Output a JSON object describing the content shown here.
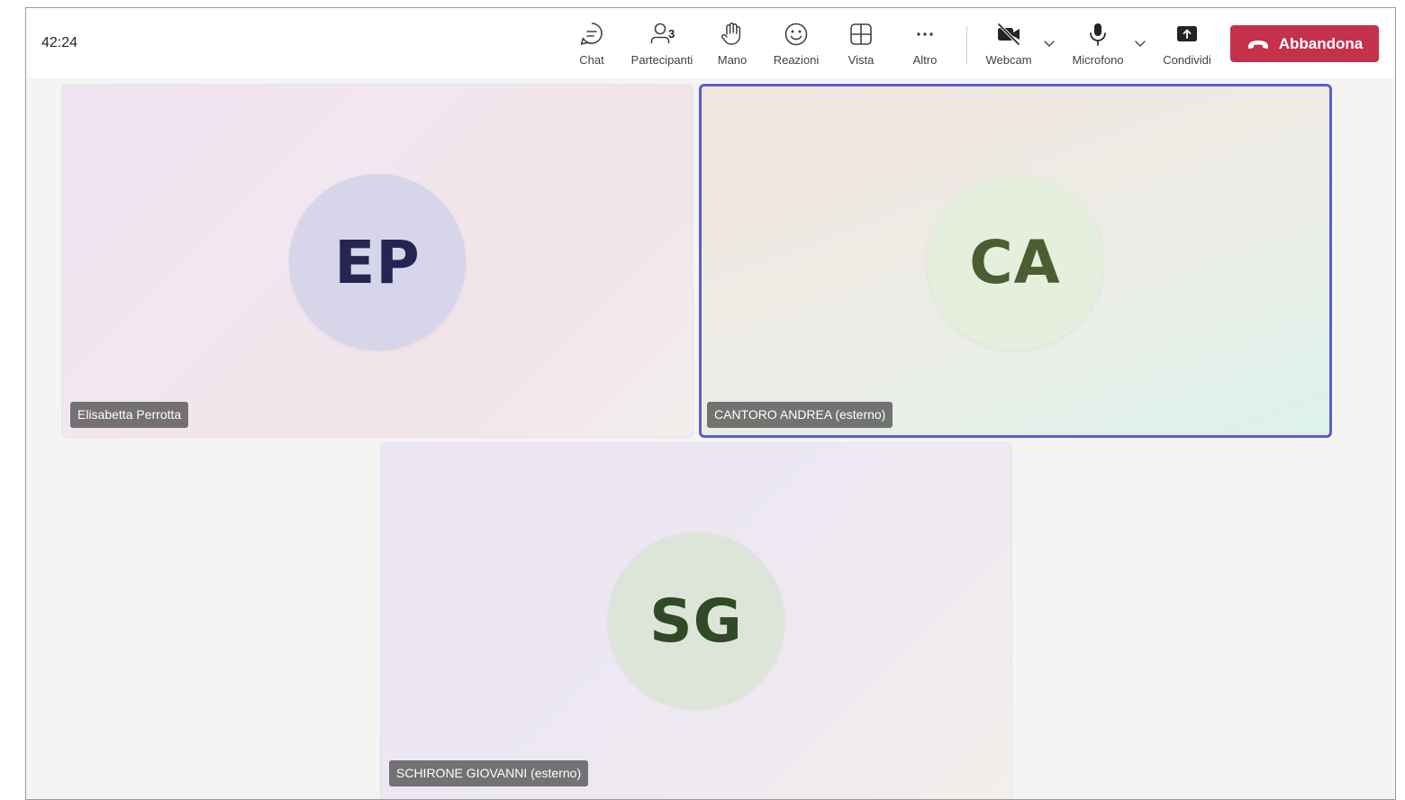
{
  "meeting": {
    "timer": "42:24"
  },
  "toolbar": {
    "chat": {
      "label": "Chat",
      "icon": "chat-icon"
    },
    "participants": {
      "label": "Partecipanti",
      "icon": "people-icon",
      "count": "3"
    },
    "hand": {
      "label": "Mano",
      "icon": "raise-hand-icon"
    },
    "reactions": {
      "label": "Reazioni",
      "icon": "smiley-icon"
    },
    "view": {
      "label": "Vista",
      "icon": "grid-view-icon"
    },
    "more": {
      "label": "Altro",
      "icon": "more-icon"
    },
    "webcam": {
      "label": "Webcam",
      "icon": "camera-off-icon"
    },
    "microphone": {
      "label": "Microfono",
      "icon": "microphone-icon"
    },
    "share": {
      "label": "Condividi",
      "icon": "share-screen-icon"
    },
    "leave": {
      "label": "Abbandona",
      "icon": "hang-up-icon",
      "color": "#c4314b"
    }
  },
  "participants": [
    {
      "initials": "EP",
      "name": "Elisabetta Perrotta",
      "avatar_color": "#d6d5ea",
      "initials_color": "#252452",
      "active_speaker": false
    },
    {
      "initials": "CA",
      "name": "CANTORO ANDREA (esterno)",
      "avatar_color": "#e6eedd",
      "initials_color": "#4a5e32",
      "active_speaker": true
    },
    {
      "initials": "SG",
      "name": "SCHIRONE GIOVANNI (esterno)",
      "avatar_color": "#dde4d8",
      "initials_color": "#2f4a25",
      "active_speaker": false
    }
  ],
  "colors": {
    "active_speaker_border": "#5b5fc7",
    "leave_button": "#c4314b"
  }
}
